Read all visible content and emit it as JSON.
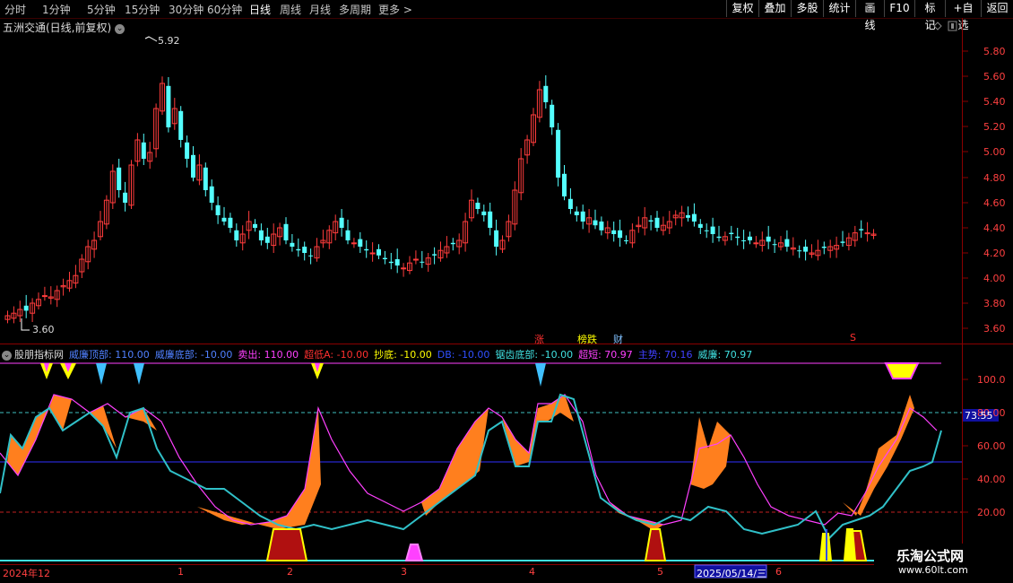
{
  "toolbar": {
    "periods": [
      "分时",
      "1分钟",
      "5分钟",
      "15分钟",
      "30分钟",
      "60分钟",
      "日线",
      "周线",
      "月线",
      "多周期",
      "更多 >"
    ],
    "active_period": "日线",
    "buttons": [
      "复权",
      "叠加",
      "多股",
      "统计",
      "画线",
      "F10",
      "标记",
      "+自选",
      "返回"
    ]
  },
  "stock": {
    "title": "五洲交通(日线,前复权)",
    "high_label": "5.92",
    "low_label": "3.60"
  },
  "price_axis": [
    "5.80",
    "5.60",
    "5.40",
    "5.20",
    "5.00",
    "4.80",
    "4.60",
    "4.40",
    "4.20",
    "4.00",
    "3.80",
    "3.60"
  ],
  "event_tags": [
    {
      "text": "涨",
      "color": "#ff3030"
    },
    {
      "text": "榜跌",
      "color": "#ffff00"
    },
    {
      "text": "财",
      "color": "#80c0ff"
    },
    {
      "text": "S",
      "color": "#ff3030"
    }
  ],
  "indicator": {
    "name": "股朋指标网",
    "params": [
      {
        "text": "威廉顶部: 110.00",
        "color": "#5080ff"
      },
      {
        "text": "威廉底部: -10.00",
        "color": "#5080ff"
      },
      {
        "text": "卖出: 110.00",
        "color": "#ff40ff"
      },
      {
        "text": "超低A: -10.00",
        "color": "#ff3030"
      },
      {
        "text": "抄底: -10.00",
        "color": "#ffff00"
      },
      {
        "text": "DB: -10.00",
        "color": "#3050ff"
      },
      {
        "text": "锯齿底部: -10.00",
        "color": "#40e0e0"
      },
      {
        "text": "超短: 70.97",
        "color": "#ff40ff"
      },
      {
        "text": "主势: 70.16",
        "color": "#4040ff"
      },
      {
        "text": "威廉: 70.97",
        "color": "#40e0e0"
      }
    ],
    "axis": [
      "100.0",
      "80.00",
      "60.00",
      "40.00",
      "20.00"
    ],
    "current_value": "73.55"
  },
  "date_axis": {
    "labels": [
      "2024年12",
      "1",
      "2",
      "3",
      "4",
      "5",
      "6"
    ],
    "cursor_date": "2025/05/14/三"
  },
  "watermark": {
    "line1": "乐淘公式网",
    "line2": "www.60lt.com"
  },
  "colors": {
    "up": "#ff3c3c",
    "down": "#54ffff",
    "orange": "#ff7f1e",
    "magenta": "#ff40ff",
    "cyan": "#40c8d0",
    "darkred": "#b01010",
    "yellow": "#ffff00"
  }
}
